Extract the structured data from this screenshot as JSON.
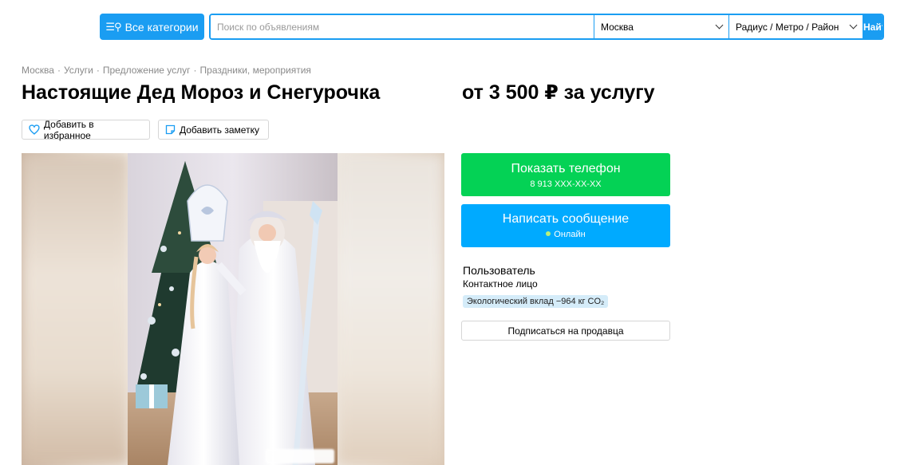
{
  "header": {
    "categories_label": "Все категории",
    "search_placeholder": "Поиск по объявлениям",
    "city": "Москва",
    "radius": "Радиус / Метро / Район",
    "find_label": "Найти"
  },
  "breadcrumb": [
    "Москва",
    "Услуги",
    "Предложение услуг",
    "Праздники, мероприятия"
  ],
  "listing": {
    "title": "Настоящие Дед Мороз и Снегурочка",
    "price": "от 3 500 ₽ за услугу",
    "favorite_label": "Добавить в избранное",
    "note_label": "Добавить заметку"
  },
  "contact": {
    "phone_label": "Показать телефон",
    "phone_number": "8 913 XXX-XX-XX",
    "message_label": "Написать сообщение",
    "online_label": "Онлайн"
  },
  "seller": {
    "name": "Пользователь",
    "role": "Контактное лицо",
    "eco_badge": "Экологический вклад −964 кг CO₂",
    "subscribe_label": "Подписаться на продавца"
  },
  "colors": {
    "accent": "#1a9df2",
    "phone_button": "#04d255",
    "message_button": "#00aaff",
    "eco_badge_bg": "#d5ecf9"
  }
}
